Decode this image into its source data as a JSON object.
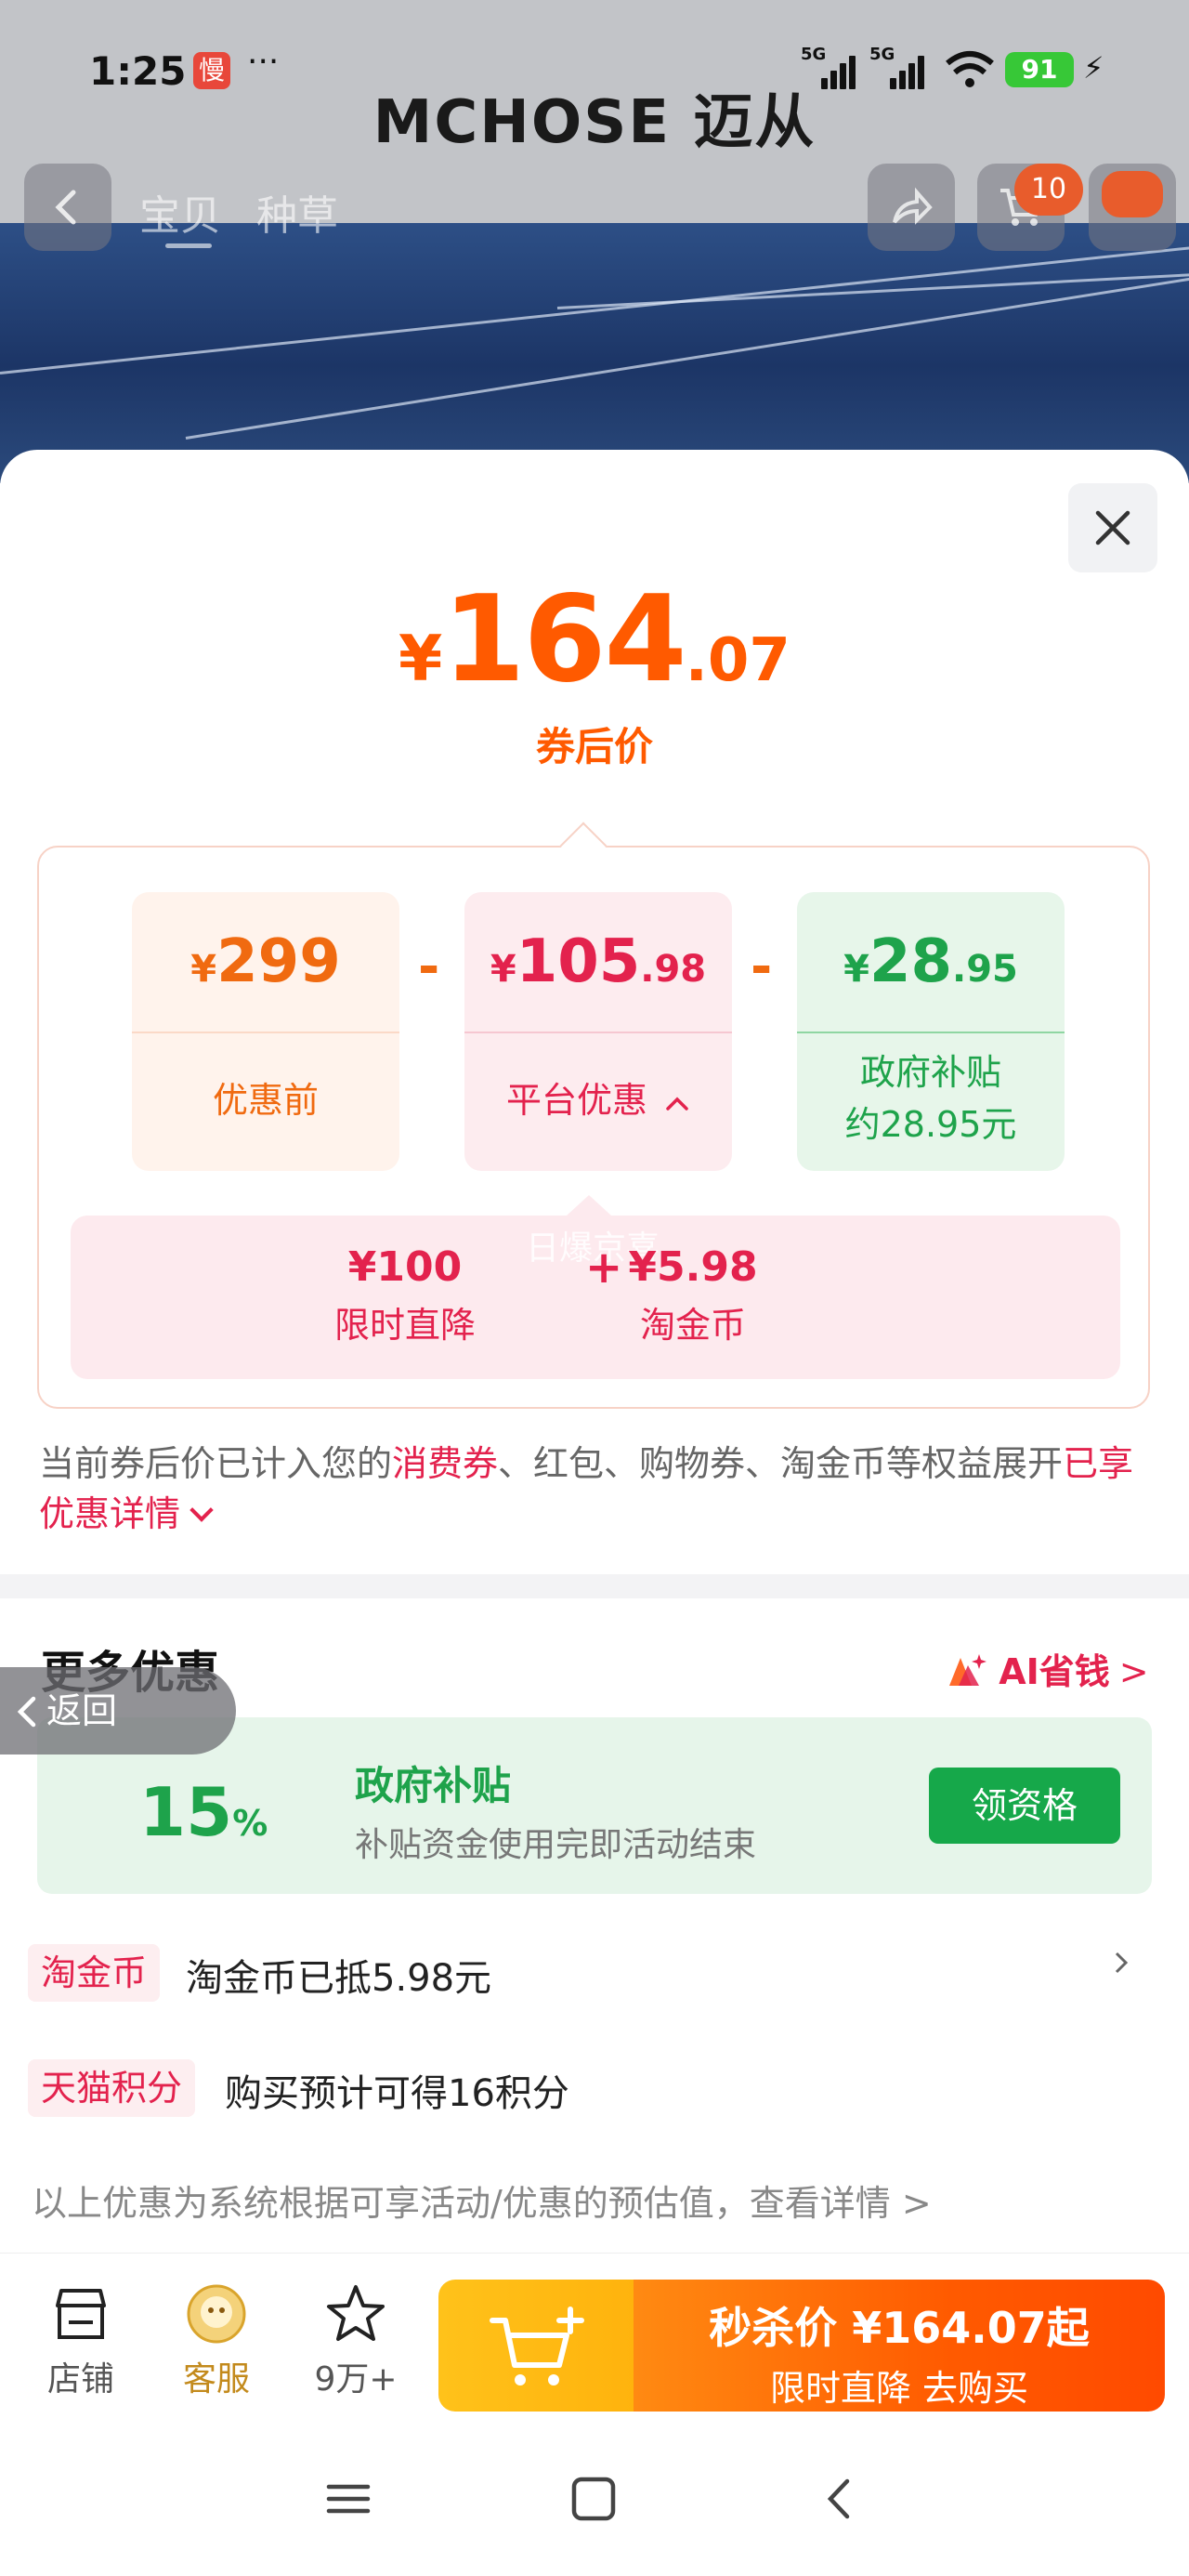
{
  "status_bar": {
    "time": "1:25",
    "slow_badge": "慢",
    "more": "···",
    "sig1": "5G",
    "sig2": "5G",
    "battery": "91"
  },
  "background": {
    "brand_logo": "MCHOSE 迈从"
  },
  "top_nav": {
    "tabs": [
      "宝贝",
      "种草"
    ],
    "cart_count": "10"
  },
  "price": {
    "currency": "¥",
    "integer": "164",
    "decimal": ".07",
    "label": "券后价"
  },
  "breakdown": {
    "original": {
      "currency": "¥",
      "integer": "299",
      "decimal": "",
      "label": "优惠前"
    },
    "platform": {
      "currency": "¥",
      "integer": "105",
      "decimal": ".98",
      "label": "平台优惠"
    },
    "subsidy": {
      "currency": "¥",
      "integer": "28",
      "decimal": ".95",
      "label_line1": "政府补贴",
      "label_line2": "约28.95元"
    },
    "minus": "-",
    "platform_detail": {
      "items": [
        {
          "amount": "¥100",
          "name": "限时直降"
        },
        {
          "amount": "¥5.98",
          "name": "淘金币"
        }
      ],
      "plus": "+",
      "watermark": "日爆京喜"
    }
  },
  "note": {
    "part1": "当前券后价已计入您的",
    "highlight": "消费券",
    "part2": "、红包、购物券、淘金币等权益展开",
    "link": "已享优惠详情"
  },
  "more_offers": {
    "title": "更多优惠",
    "ai_label": "AI省钱",
    "ai_arrow": ">",
    "back_label": "返回",
    "gov_card": {
      "percent": "15",
      "percent_sign": "%",
      "title": "政府补贴",
      "desc": "补贴资金使用完即活动结束",
      "button": "领资格"
    },
    "rows": [
      {
        "tag": "淘金币",
        "text": "淘金币已抵5.98元"
      },
      {
        "tag": "天猫积分",
        "text": "购买预计可得16积分"
      }
    ],
    "footnote": "以上优惠为系统根据可享活动/优惠的预估值，查看详情 >"
  },
  "bottom_bar": {
    "store": "店铺",
    "service": "客服",
    "favorites": "9万+",
    "cta_line1_prefix": "秒杀价 ¥",
    "cta_price": "164.07",
    "cta_line1_suffix": "起",
    "cta_line2": "限时直降  去购买"
  },
  "colors": {
    "accent_orange": "#ff5a00",
    "discount_red": "#e3224d",
    "subsidy_green": "#1ea34b"
  }
}
